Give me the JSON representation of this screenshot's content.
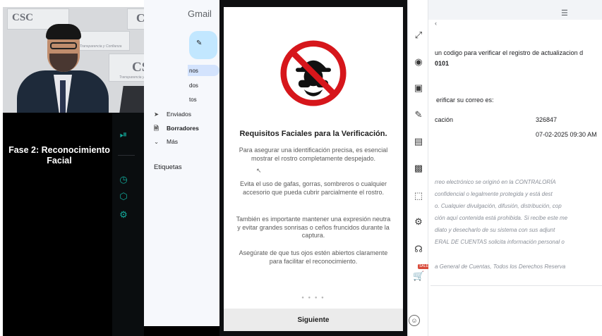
{
  "presenter": {
    "phase_title": "Fase 2: Reconocimiento Facial",
    "banner_logo": "CSC",
    "banner_slogan": "Transparencia y Confianza"
  },
  "gmail": {
    "brand": "Gmail",
    "nav_fragments": [
      "nos",
      "dos",
      "tos"
    ],
    "items": [
      {
        "label": "Enviados",
        "icon": "send-icon"
      },
      {
        "label": "Borradores",
        "icon": "draft-icon"
      },
      {
        "label": "Más",
        "icon": "chevron-down-icon"
      }
    ],
    "labels_heading": "Etiquetas"
  },
  "phone": {
    "title": "Requisitos Faciales para la Verificación.",
    "paragraphs": [
      "Para asegurar una identificación precisa, es esencial mostrar el rostro completamente despejado.",
      "Evita el uso de gafas, gorras, sombreros o cualquier accesorio que pueda cubrir parcialmente el rostro.",
      "También es importante mantener una expresión neutra y evitar grandes sonrisas o ceños fruncidos durante la captura.",
      "Asegúrate de que tus ojos estén abiertos claramente para facilitar el reconocimiento."
    ],
    "next_button": "Siguiente",
    "sign_icon": "no-glasses-hat-icon",
    "pager_dots": "● ● ● ●"
  },
  "toolbar": {
    "icons": [
      "expand-icon",
      "camera-icon",
      "record-icon",
      "pen-icon",
      "calendar-icon",
      "note-icon",
      "crop-icon",
      "settings-icon",
      "headset-icon",
      "cart-icon",
      "emoji-icon"
    ],
    "sale_badge": "SALE"
  },
  "email": {
    "line1": "un codigo para verificar el registro de actualizacion d",
    "line1_code": "0101",
    "line2": "erificar su correo es:",
    "row_label": "cación",
    "row_value": "326847",
    "row_date": "07-02-2025 09:30 AM",
    "legal": [
      "rreo electrónico se originó en la CONTRALORÍA",
      "confidencial o legalmente protegida y está dest",
      "o. Cualquier divulgación, difusión, distribución, cop",
      "ción aquí contenida está prohibida. Si recibe este me",
      "diato y desecharlo de su sistema con sus adjunt",
      "ERAL DE CUENTAS solicita información personal o"
    ],
    "footer": "a General de Cuentas, Todos los Derechos Reserva"
  },
  "colors": {
    "accent_teal": "#12a99a",
    "sign_red": "#d6161b",
    "compose_blue": "#c2e7ff"
  }
}
